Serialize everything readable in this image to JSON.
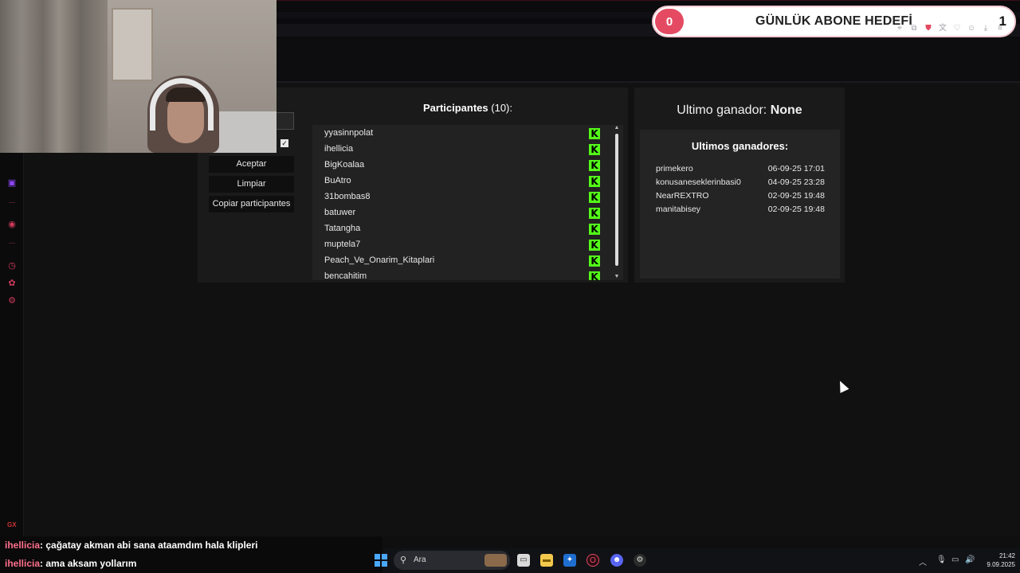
{
  "goal_widget": {
    "current": "0",
    "title": "GÜNLÜK ABONE HEDEFİ",
    "target": "1"
  },
  "controls": {
    "accept_label": "Aceptar",
    "clear_label": "Limpiar",
    "copy_label": "Copiar participantes"
  },
  "participants": {
    "title": "Participantes",
    "count": "(10):",
    "items": [
      "yyasinnpolat",
      "ihellicia",
      "BigKoalaa",
      "BuAtro",
      "31bombas8",
      "batuwer",
      "Tatangha",
      "muptela7",
      "Peach_Ve_Onarim_Kitaplari",
      "bencahitim"
    ],
    "platform_icon": "kick-icon",
    "platform_color": "#53fc18"
  },
  "winner": {
    "label": "Ultimo ganador:",
    "value": "None",
    "history_title": "Ultimos ganadores:",
    "history": [
      {
        "name": "primekero",
        "date": "06-09-25 17:01"
      },
      {
        "name": "konusaneseklerinbasi0",
        "date": "04-09-25 23:28"
      },
      {
        "name": "NearREXTRO",
        "date": "02-09-25 19:48"
      },
      {
        "name": "manitabisey",
        "date": "02-09-25 19:48"
      }
    ]
  },
  "chat": [
    {
      "user": "ihellicia",
      "message": ": çağatay akman abi sana ataamdım hala klipleri"
    },
    {
      "user": "ihellicia",
      "message": ": ama aksam yollarım"
    }
  ],
  "taskbar": {
    "search_placeholder": "Ara",
    "time": "21:42",
    "date": "9.09.2025"
  },
  "sidebar": {
    "brand": "GX"
  },
  "colors": {
    "accent": "#e44b63",
    "kick_green": "#53fc18",
    "panel": "#1a1a1a"
  }
}
